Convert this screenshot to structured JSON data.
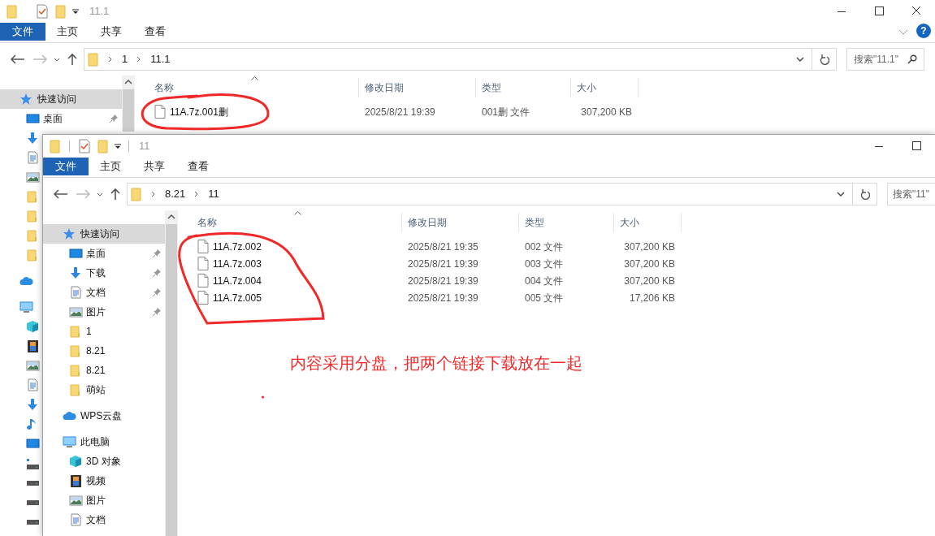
{
  "windows": [
    {
      "title": "11.1",
      "quick_toolbar_dividers": false,
      "ribbon_tabs": [
        {
          "label": "文件",
          "selected": true
        },
        {
          "label": "主页",
          "selected": false
        },
        {
          "label": "共享",
          "selected": false
        },
        {
          "label": "查看",
          "selected": false
        }
      ],
      "help": "?",
      "path": [
        "1",
        "11.1"
      ],
      "search": {
        "placeholder": "搜索\"11.1\""
      },
      "nav": [
        {
          "label": "快速访问",
          "kind": "star",
          "selected": true,
          "children": [
            {
              "label": "桌面",
              "kind": "desktop",
              "pinned": true,
              "selected": false
            },
            {
              "kind": "download",
              "selected": false
            },
            {
              "kind": "document",
              "selected": false
            },
            {
              "kind": "picture",
              "selected": false
            },
            {
              "kind": "folder",
              "selected": false
            },
            {
              "kind": "folder",
              "selected": false
            },
            {
              "kind": "folder",
              "selected": false
            },
            {
              "kind": "folder",
              "selected": false
            }
          ]
        },
        {
          "kind": "cloud",
          "selected": false
        },
        {
          "kind": "pc",
          "selected": false,
          "children": [
            {
              "kind": "cube",
              "selected": false
            },
            {
              "kind": "video",
              "selected": false
            },
            {
              "kind": "picture",
              "selected": false
            },
            {
              "kind": "document",
              "selected": false
            },
            {
              "kind": "download",
              "selected": false
            },
            {
              "kind": "music",
              "selected": false
            },
            {
              "kind": "desktop",
              "selected": false
            },
            {
              "kind": "system-drive",
              "selected": false
            },
            {
              "kind": "drive",
              "selected": false
            },
            {
              "kind": "drive",
              "selected": false
            },
            {
              "kind": "drive",
              "selected": false
            }
          ]
        }
      ],
      "columns": [
        {
          "label": "名称",
          "sorted": true
        },
        {
          "label": "修改日期"
        },
        {
          "label": "类型"
        },
        {
          "label": "大小"
        }
      ],
      "files": [
        {
          "name": "11A.7z.001删",
          "date": "2025/8/21 19:39",
          "type": "001删 文件",
          "size": "307,200 KB"
        }
      ]
    },
    {
      "title": "11",
      "quick_toolbar_dividers": true,
      "ribbon_tabs": [
        {
          "label": "文件",
          "selected": true
        },
        {
          "label": "主页",
          "selected": false
        },
        {
          "label": "共享",
          "selected": false
        },
        {
          "label": "查看",
          "selected": false
        }
      ],
      "path": [
        "8.21",
        "11"
      ],
      "search": {
        "placeholder": "搜索\"11\""
      },
      "nav": [
        {
          "label": "快速访问",
          "kind": "star",
          "selected": true,
          "children": [
            {
              "label": "桌面",
              "kind": "desktop",
              "pinned": true,
              "selected": false
            },
            {
              "label": "下载",
              "kind": "download",
              "pinned": true,
              "selected": false
            },
            {
              "label": "文档",
              "kind": "document",
              "pinned": true,
              "selected": false
            },
            {
              "label": "图片",
              "kind": "picture",
              "pinned": true,
              "selected": false
            },
            {
              "label": "1",
              "kind": "folder",
              "pinned": false,
              "selected": false
            },
            {
              "label": "8.21",
              "kind": "folder",
              "pinned": false,
              "selected": false
            },
            {
              "label": "8.21",
              "kind": "folder",
              "pinned": false,
              "selected": false
            },
            {
              "label": "萌站",
              "kind": "folder",
              "pinned": false,
              "selected": false
            }
          ]
        },
        {
          "label": "WPS云盘",
          "kind": "cloud",
          "selected": false
        },
        {
          "label": "此电脑",
          "kind": "pc",
          "selected": false,
          "children": [
            {
              "label": "3D 对象",
              "kind": "cube",
              "selected": false
            },
            {
              "label": "视频",
              "kind": "video",
              "selected": false
            },
            {
              "label": "图片",
              "kind": "picture",
              "selected": false
            },
            {
              "label": "文档",
              "kind": "document",
              "selected": false
            }
          ]
        }
      ],
      "columns": [
        {
          "label": "名称",
          "sorted": true
        },
        {
          "label": "修改日期"
        },
        {
          "label": "类型"
        },
        {
          "label": "大小"
        }
      ],
      "files": [
        {
          "name": "11A.7z.002",
          "date": "2025/8/21 19:35",
          "type": "002 文件",
          "size": "307,200 KB"
        },
        {
          "name": "11A.7z.003",
          "date": "2025/8/21 19:39",
          "type": "003 文件",
          "size": "307,200 KB"
        },
        {
          "name": "11A.7z.004",
          "date": "2025/8/21 19:39",
          "type": "004 文件",
          "size": "307,200 KB"
        },
        {
          "name": "11A.7z.005",
          "date": "2025/8/21 19:39",
          "type": "005 文件",
          "size": "17,206 KB"
        }
      ]
    }
  ],
  "annotations": {
    "note": "内容采用分盘，把两个链接下载放在一起",
    "marks": [
      {
        "kind": "circle"
      },
      {
        "kind": "circle"
      },
      {
        "kind": "dot"
      }
    ]
  }
}
